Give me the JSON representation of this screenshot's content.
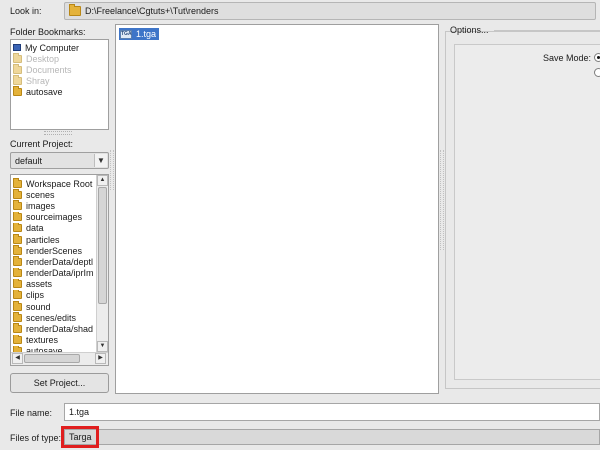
{
  "look_in": {
    "label": "Look in:",
    "path": "D:\\Freelance\\Cgtuts+\\Tut\\renders"
  },
  "bookmarks": {
    "label": "Folder Bookmarks:",
    "items": [
      {
        "label": "My Computer",
        "icon": "computer-icon",
        "dim": false
      },
      {
        "label": "Desktop",
        "icon": "folder-icon",
        "dim": true
      },
      {
        "label": "Documents",
        "icon": "folder-icon",
        "dim": true
      },
      {
        "label": "Shray",
        "icon": "folder-icon",
        "dim": true
      },
      {
        "label": "autosave",
        "icon": "folder-icon",
        "dim": false
      }
    ]
  },
  "project": {
    "label": "Current Project:",
    "selected": "default",
    "set_button": "Set Project..."
  },
  "folders": [
    "Workspace Root",
    "scenes",
    "images",
    "sourceimages",
    "data",
    "particles",
    "renderScenes",
    "renderData/deptl",
    "renderData/iprIm",
    "assets",
    "clips",
    "sound",
    "scenes/edits",
    "renderData/shad",
    "textures",
    "autosave"
  ],
  "files": [
    {
      "name": "1.tga",
      "icon": "tga-file-icon",
      "selected": true
    }
  ],
  "options": {
    "legend": "Options...",
    "save_mode_label": "Save Mode:"
  },
  "file_name": {
    "label": "File name:",
    "value": "1.tga"
  },
  "file_type": {
    "label": "Files of type:",
    "value": "Targa"
  },
  "colors": {
    "selection": "#3e75c8",
    "folder": "#e4b23a",
    "highlight_box": "#e01e1e"
  }
}
